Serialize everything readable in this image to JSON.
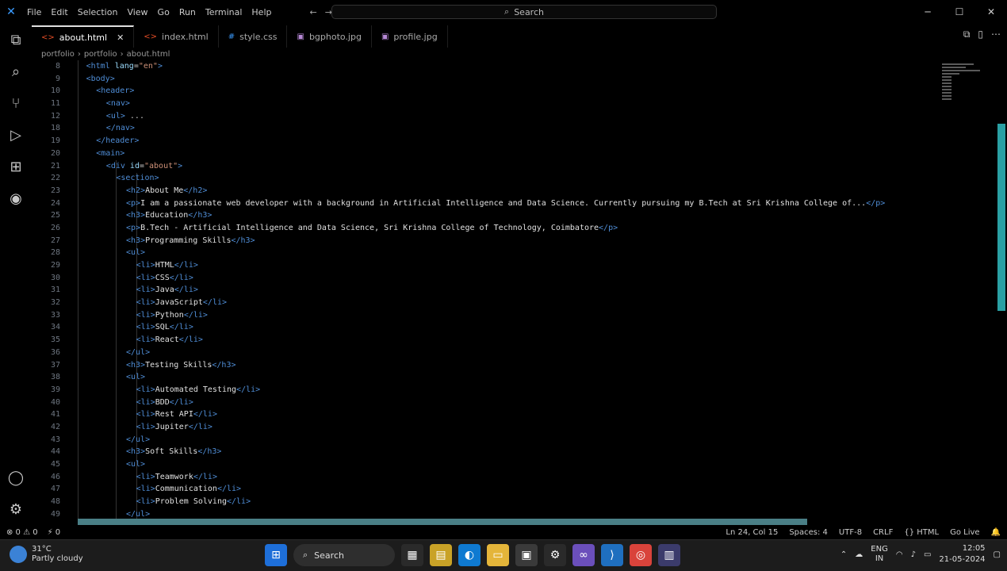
{
  "titlebar": {
    "menu": [
      "File",
      "Edit",
      "Selection",
      "View",
      "Go",
      "Run",
      "Terminal",
      "Help"
    ],
    "search_placeholder": "Search",
    "nav_back": "←",
    "nav_forward": "→"
  },
  "activity": {
    "items": [
      {
        "name": "explorer-icon",
        "glyph": "⧉"
      },
      {
        "name": "search-icon",
        "glyph": "⌕"
      },
      {
        "name": "source-control-icon",
        "glyph": "⑂"
      },
      {
        "name": "run-debug-icon",
        "glyph": "▷"
      },
      {
        "name": "extensions-icon",
        "glyph": "⊞"
      },
      {
        "name": "copilot-icon",
        "glyph": "◉"
      }
    ],
    "bottom": [
      {
        "name": "account-icon",
        "glyph": "◯"
      },
      {
        "name": "settings-gear-icon",
        "glyph": "⚙"
      }
    ]
  },
  "tabs": [
    {
      "label": "about.html",
      "type": "html",
      "active": true
    },
    {
      "label": "index.html",
      "type": "html",
      "active": false
    },
    {
      "label": "style.css",
      "type": "css",
      "active": false
    },
    {
      "label": "bgphoto.jpg",
      "type": "img",
      "active": false
    },
    {
      "label": "profile.jpg",
      "type": "img",
      "active": false
    }
  ],
  "breadcrumb": [
    "portfolio",
    "portfolio",
    "about.html"
  ],
  "editor": {
    "lines": [
      {
        "n": "8",
        "indent": 2,
        "html": "<span class='tag'>&lt;html</span> <span class='attr'>lang</span>=<span class='str'>\"en\"</span><span class='tag'>&gt;</span>"
      },
      {
        "n": "9",
        "indent": 2,
        "html": "<span class='tag'>&lt;body&gt;</span>"
      },
      {
        "n": "10",
        "indent": 4,
        "html": "<span class='tag'>&lt;header&gt;</span>"
      },
      {
        "n": "11",
        "indent": 6,
        "html": "<span class='tag'>&lt;nav&gt;</span>"
      },
      {
        "n": "12",
        "indent": 6,
        "html": "<span class='tag'>&lt;ul&gt;</span> ..."
      },
      {
        "n": "18",
        "indent": 6,
        "html": "<span class='tag'>&lt;/nav&gt;</span>"
      },
      {
        "n": "19",
        "indent": 4,
        "html": "<span class='tag'>&lt;/header&gt;</span>"
      },
      {
        "n": "20",
        "indent": 4,
        "html": "<span class='tag'>&lt;main&gt;</span>"
      },
      {
        "n": "21",
        "indent": 6,
        "html": "<span class='tag'>&lt;div</span> <span class='attr'>id</span>=<span class='str'>\"about\"</span><span class='tag'>&gt;</span>"
      },
      {
        "n": "22",
        "indent": 8,
        "html": "<span class='tag'>&lt;section&gt;</span>"
      },
      {
        "n": "23",
        "indent": 10,
        "html": "<span class='tag'>&lt;h2&gt;</span><span class='txt'>About Me</span><span class='tag'>&lt;/h2&gt;</span>"
      },
      {
        "n": "24",
        "indent": 10,
        "html": "<span class='tag'>&lt;p&gt;</span><span class='txt'>I am a passionate web developer with a background in Artificial Intelligence and Data Science. Currently pursuing my B.Tech at Sri Krishna College of...</span><span class='tag'>&lt;/p&gt;</span>"
      },
      {
        "n": "25",
        "indent": 10,
        "html": "<span class='tag'>&lt;h3&gt;</span><span class='txt'>Education</span><span class='tag'>&lt;/h3&gt;</span>"
      },
      {
        "n": "26",
        "indent": 10,
        "html": "<span class='tag'>&lt;p&gt;</span><span class='txt'>B.Tech - Artificial Intelligence and Data Science, Sri Krishna College of Technology, Coimbatore</span><span class='tag'>&lt;/p&gt;</span>"
      },
      {
        "n": "27",
        "indent": 10,
        "html": "<span class='tag'>&lt;h3&gt;</span><span class='txt'>Programming Skills</span><span class='tag'>&lt;/h3&gt;</span>"
      },
      {
        "n": "28",
        "indent": 10,
        "html": "<span class='tag'>&lt;ul&gt;</span>"
      },
      {
        "n": "29",
        "indent": 12,
        "html": "<span class='tag'>&lt;li&gt;</span><span class='txt'>HTML</span><span class='tag'>&lt;/li&gt;</span>"
      },
      {
        "n": "30",
        "indent": 12,
        "html": "<span class='tag'>&lt;li&gt;</span><span class='txt'>CSS</span><span class='tag'>&lt;/li&gt;</span>"
      },
      {
        "n": "31",
        "indent": 12,
        "html": "<span class='tag'>&lt;li&gt;</span><span class='txt'>Java</span><span class='tag'>&lt;/li&gt;</span>"
      },
      {
        "n": "32",
        "indent": 12,
        "html": "<span class='tag'>&lt;li&gt;</span><span class='txt'>JavaScript</span><span class='tag'>&lt;/li&gt;</span>"
      },
      {
        "n": "33",
        "indent": 12,
        "html": "<span class='tag'>&lt;li&gt;</span><span class='txt'>Python</span><span class='tag'>&lt;/li&gt;</span>"
      },
      {
        "n": "34",
        "indent": 12,
        "html": "<span class='tag'>&lt;li&gt;</span><span class='txt'>SQL</span><span class='tag'>&lt;/li&gt;</span>"
      },
      {
        "n": "35",
        "indent": 12,
        "html": "<span class='tag'>&lt;li&gt;</span><span class='txt'>React</span><span class='tag'>&lt;/li&gt;</span>"
      },
      {
        "n": "36",
        "indent": 10,
        "html": "<span class='tag'>&lt;/ul&gt;</span>"
      },
      {
        "n": "37",
        "indent": 10,
        "html": "<span class='tag'>&lt;h3&gt;</span><span class='txt'>Testing Skills</span><span class='tag'>&lt;/h3&gt;</span>"
      },
      {
        "n": "38",
        "indent": 10,
        "html": "<span class='tag'>&lt;ul&gt;</span>"
      },
      {
        "n": "39",
        "indent": 12,
        "html": "<span class='tag'>&lt;li&gt;</span><span class='txt'>Automated Testing</span><span class='tag'>&lt;/li&gt;</span>"
      },
      {
        "n": "40",
        "indent": 12,
        "html": "<span class='tag'>&lt;li&gt;</span><span class='txt'>BDD</span><span class='tag'>&lt;/li&gt;</span>"
      },
      {
        "n": "41",
        "indent": 12,
        "html": "<span class='tag'>&lt;li&gt;</span><span class='txt'>Rest API</span><span class='tag'>&lt;/li&gt;</span>"
      },
      {
        "n": "42",
        "indent": 12,
        "html": "<span class='tag'>&lt;li&gt;</span><span class='txt'>Jupiter</span><span class='tag'>&lt;/li&gt;</span>"
      },
      {
        "n": "43",
        "indent": 10,
        "html": "<span class='tag'>&lt;/ul&gt;</span>"
      },
      {
        "n": "44",
        "indent": 10,
        "html": "<span class='tag'>&lt;h3&gt;</span><span class='txt'>Soft Skills</span><span class='tag'>&lt;/h3&gt;</span>"
      },
      {
        "n": "45",
        "indent": 10,
        "html": "<span class='tag'>&lt;ul&gt;</span>"
      },
      {
        "n": "46",
        "indent": 12,
        "html": "<span class='tag'>&lt;li&gt;</span><span class='txt'>Teamwork</span><span class='tag'>&lt;/li&gt;</span>"
      },
      {
        "n": "47",
        "indent": 12,
        "html": "<span class='tag'>&lt;li&gt;</span><span class='txt'>Communication</span><span class='tag'>&lt;/li&gt;</span>"
      },
      {
        "n": "48",
        "indent": 12,
        "html": "<span class='tag'>&lt;li&gt;</span><span class='txt'>Problem Solving</span><span class='tag'>&lt;/li&gt;</span>"
      },
      {
        "n": "49",
        "indent": 10,
        "html": "<span class='tag'>&lt;/ul&gt;</span>"
      }
    ]
  },
  "statusbar": {
    "left": [
      "⊗ 0 ⚠ 0",
      "⚡ 0"
    ],
    "right": [
      "Ln 24, Col 15",
      "Spaces: 4",
      "UTF-8",
      "CRLF",
      "{} HTML",
      "Go Live",
      "🔔"
    ]
  },
  "taskbar": {
    "weather_temp": "31°C",
    "weather_desc": "Partly cloudy",
    "search_label": "Search",
    "apps": [
      {
        "name": "start-icon",
        "glyph": "⊞",
        "bg": "#1e6fd9"
      },
      {
        "name": "file-explorer-icon",
        "glyph": "▦",
        "bg": "#2a2a2a"
      },
      {
        "name": "notes-icon",
        "glyph": "▤",
        "bg": "#c9a227"
      },
      {
        "name": "edge-icon",
        "glyph": "◐",
        "bg": "#0f7ad1"
      },
      {
        "name": "folder-icon",
        "glyph": "▭",
        "bg": "#e4b53a"
      },
      {
        "name": "store-icon",
        "glyph": "▣",
        "bg": "#3a3a3a"
      },
      {
        "name": "settings-icon",
        "glyph": "⚙",
        "bg": "#2a2a2a"
      },
      {
        "name": "visual-studio-icon",
        "glyph": "∞",
        "bg": "#6b4fbb"
      },
      {
        "name": "vscode-icon",
        "glyph": "⟩",
        "bg": "#1f6fbf"
      },
      {
        "name": "chrome-icon",
        "glyph": "◎",
        "bg": "#d9433b"
      },
      {
        "name": "app-icon",
        "glyph": "▥",
        "bg": "#3b3b6b"
      }
    ],
    "tray": {
      "lang": "ENG",
      "lang2": "IN",
      "time": "12:05",
      "date": "21-05-2024"
    }
  },
  "colors": {
    "accent": "#2aa0a4",
    "html_icon": "#e44d26",
    "css_icon": "#3b9cff"
  }
}
